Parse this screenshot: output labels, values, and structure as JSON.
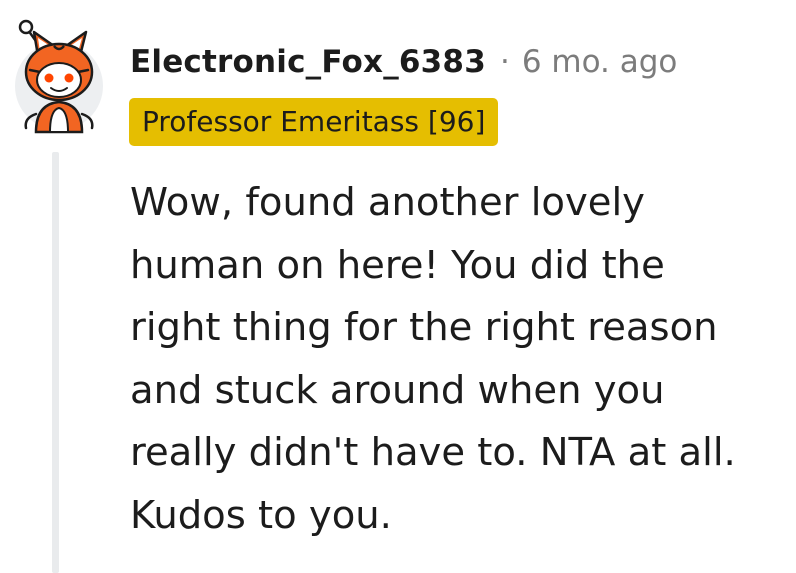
{
  "comment": {
    "author": "Electronic_Fox_6383",
    "separator": "·",
    "timestamp": "6 mo. ago",
    "flair": "Professor Emeritass [96]",
    "body_lines": [
      "Wow, found another lovely",
      "human on here! You did the",
      "right thing for the right reason",
      "and stuck around when you",
      "really didn't have to. NTA at all.",
      "Kudos to you."
    ]
  },
  "icons": {
    "avatar": "fox-snoo-avatar-icon"
  },
  "colors": {
    "flair_background": "#e5be01",
    "username": "#1c1c1c",
    "meta": "#7c7c7c",
    "thread_line": "#e9ebed",
    "avatar_orange": "#f26522"
  }
}
